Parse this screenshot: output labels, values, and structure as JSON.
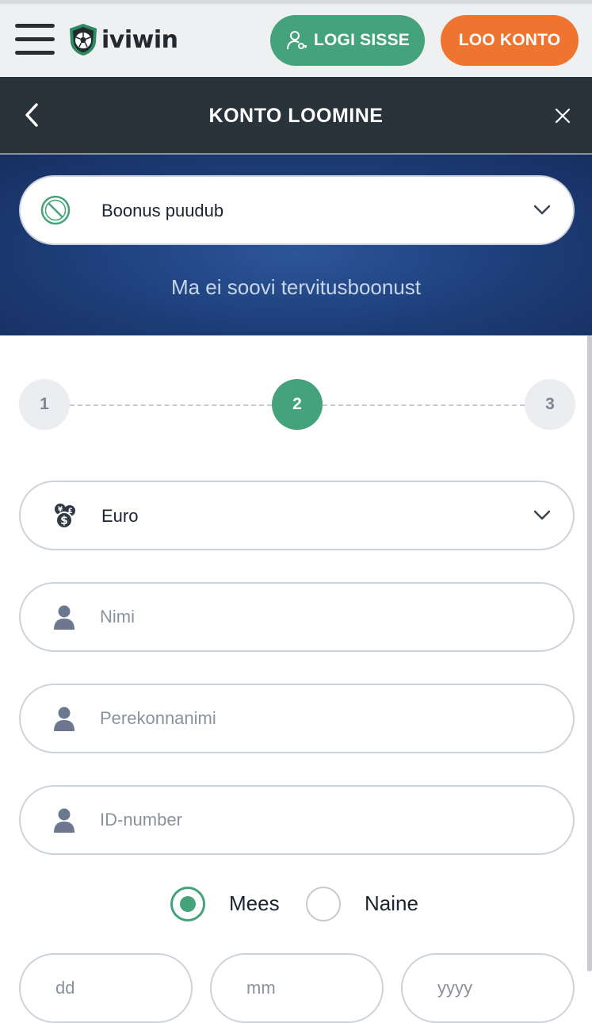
{
  "header": {
    "logo_text": "iviwin",
    "login_label": "LOGI SISSE",
    "register_label": "LOO KONTO"
  },
  "modal": {
    "title": "KONTO LOOMINE"
  },
  "bonus": {
    "selected_label": "Boonus puudub",
    "subtitle": "Ma ei soovi tervitusboonust"
  },
  "steps": [
    {
      "label": "1",
      "state": "inactive"
    },
    {
      "label": "2",
      "state": "active"
    },
    {
      "label": "3",
      "state": "inactive"
    }
  ],
  "form": {
    "currency_value": "Euro",
    "first_name_placeholder": "Nimi",
    "last_name_placeholder": "Perekonnanimi",
    "id_placeholder": "ID-number",
    "gender_male_label": "Mees",
    "gender_female_label": "Naine",
    "gender_selected": "Mees",
    "day_placeholder": "dd",
    "month_placeholder": "mm",
    "year_placeholder": "yyyy"
  },
  "colors": {
    "accent_green": "#44a37a",
    "accent_orange": "#ef7430",
    "header_dark": "#28333a",
    "bonus_blue": "#1d3d78"
  },
  "icons": {
    "menu": "hamburger-icon",
    "login": "user-key-icon",
    "back": "chevron-left-icon",
    "close": "close-icon",
    "bonus": "no-bonus-icon",
    "dropdown": "chevron-down-icon",
    "currency": "currency-coins-icon",
    "person": "person-icon"
  }
}
